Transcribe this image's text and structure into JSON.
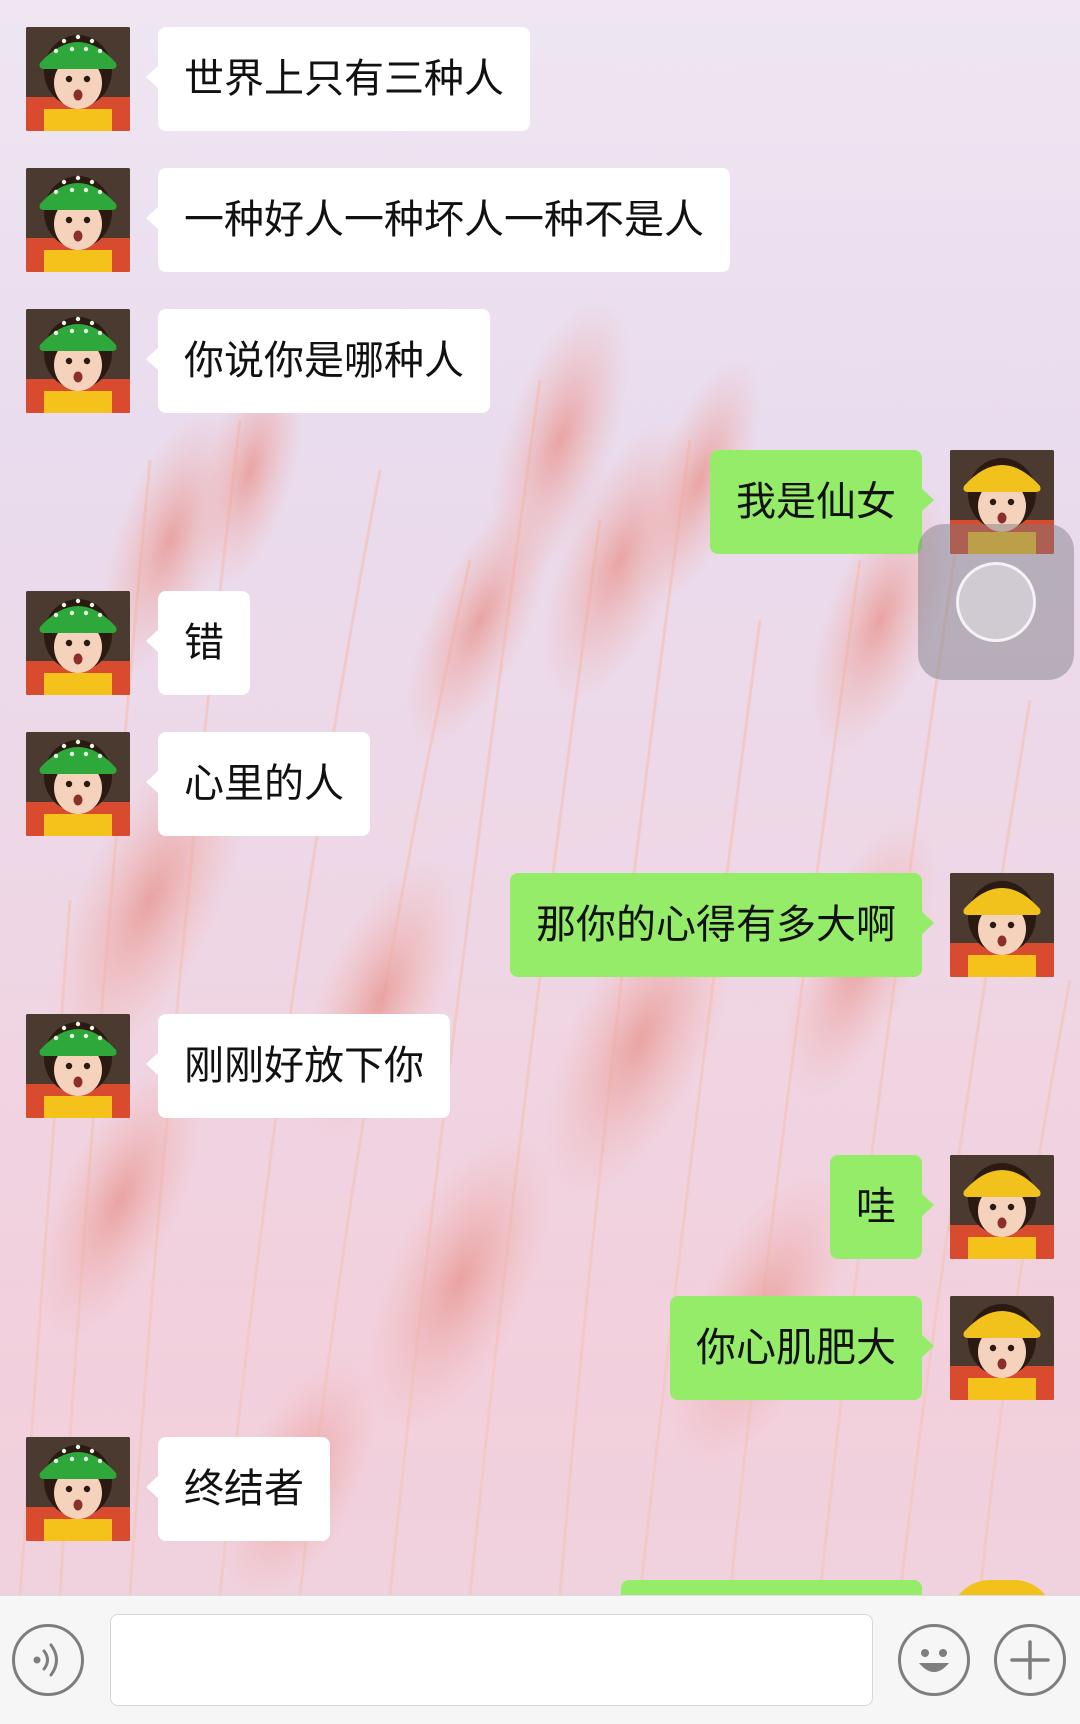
{
  "chat": {
    "messages": [
      {
        "side": "left",
        "text": "世界上只有三种人"
      },
      {
        "side": "left",
        "text": "一种好人一种坏人一种不是人"
      },
      {
        "side": "left",
        "text": "你说你是哪种人"
      },
      {
        "side": "right",
        "text": "我是仙女"
      },
      {
        "side": "left",
        "text": "错"
      },
      {
        "side": "left",
        "text": "心里的人"
      },
      {
        "side": "right",
        "text": "那你的心得有多大啊"
      },
      {
        "side": "left",
        "text": "刚刚好放下你"
      },
      {
        "side": "right",
        "text": "哇"
      },
      {
        "side": "right",
        "text": "你心肌肥大"
      },
      {
        "side": "left",
        "text": "终结者"
      }
    ]
  },
  "input_bar": {
    "placeholder": "",
    "icons": [
      "voice-icon",
      "emoji-icon",
      "plus-icon"
    ]
  },
  "colors": {
    "sent_bubble": "#95ec69",
    "received_bubble": "#ffffff",
    "left_hat": "#2ea83a",
    "right_hat": "#f1c21b"
  }
}
